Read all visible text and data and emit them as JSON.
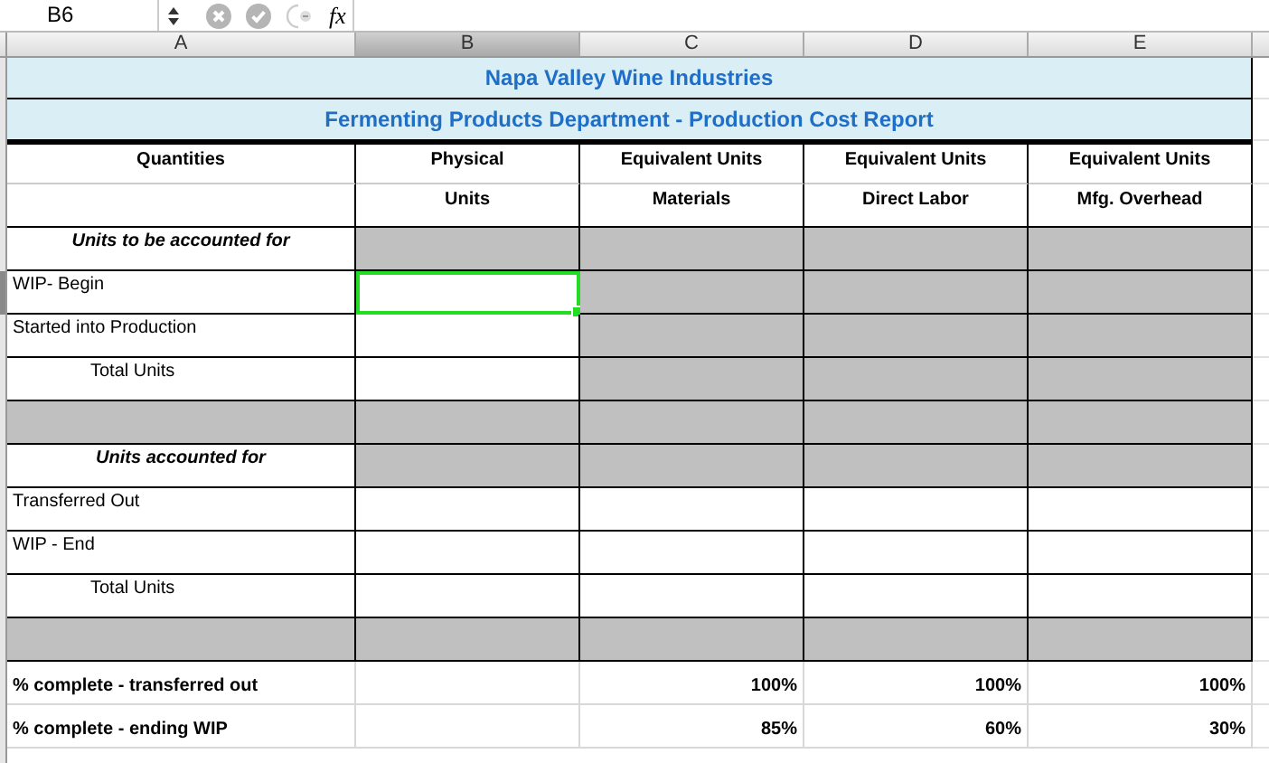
{
  "formula_bar": {
    "cell_ref": "B6",
    "fx": "fx"
  },
  "columns": [
    {
      "label": "A",
      "selected": false
    },
    {
      "label": "B",
      "selected": true
    },
    {
      "label": "C",
      "selected": false
    },
    {
      "label": "D",
      "selected": false
    },
    {
      "label": "E",
      "selected": false
    }
  ],
  "titles": [
    "Napa Valley Wine Industries",
    "Fermenting Products Department - Production Cost Report"
  ],
  "rows": [
    {
      "kind": "header",
      "cells": [
        {
          "text": "Quantities",
          "shaded": false,
          "selected": false
        },
        {
          "text": "Physical",
          "shaded": false,
          "selected": false
        },
        {
          "text": "Equivalent Units",
          "shaded": false,
          "selected": false
        },
        {
          "text": "Equivalent Units",
          "shaded": false,
          "selected": false
        },
        {
          "text": "Equivalent Units",
          "shaded": false,
          "selected": false
        }
      ]
    },
    {
      "kind": "header",
      "cells": [
        {
          "shaded": false,
          "selected": false
        },
        {
          "text": "Units",
          "shaded": false,
          "selected": false
        },
        {
          "text": "Materials",
          "shaded": false,
          "selected": false
        },
        {
          "text": "Direct Labor",
          "shaded": false,
          "selected": false
        },
        {
          "text": "Mfg. Overhead",
          "shaded": false,
          "selected": false
        }
      ]
    },
    {
      "kind": "section",
      "cells": [
        {
          "text": "Units to be accounted for",
          "shaded": false,
          "selected": false
        },
        {
          "shaded": true,
          "selected": false
        },
        {
          "shaded": true,
          "selected": false
        },
        {
          "shaded": true,
          "selected": false
        },
        {
          "shaded": true,
          "selected": false
        }
      ]
    },
    {
      "kind": "data",
      "cells": [
        {
          "text": "WIP- Begin",
          "shaded": false,
          "selected": false
        },
        {
          "shaded": false,
          "selected": true
        },
        {
          "shaded": true,
          "selected": false
        },
        {
          "shaded": true,
          "selected": false
        },
        {
          "shaded": true,
          "selected": false
        }
      ]
    },
    {
      "kind": "data",
      "cells": [
        {
          "text": "Started into Production",
          "shaded": false,
          "selected": false
        },
        {
          "shaded": false,
          "selected": false
        },
        {
          "shaded": true,
          "selected": false
        },
        {
          "shaded": true,
          "selected": false
        },
        {
          "shaded": true,
          "selected": false
        }
      ]
    },
    {
      "kind": "total",
      "cells": [
        {
          "text": "Total Units",
          "shaded": false,
          "selected": false
        },
        {
          "shaded": false,
          "selected": false
        },
        {
          "shaded": true,
          "selected": false
        },
        {
          "shaded": true,
          "selected": false
        },
        {
          "shaded": true,
          "selected": false
        }
      ]
    },
    {
      "kind": "data",
      "cells": [
        {
          "shaded": true,
          "selected": false
        },
        {
          "shaded": true,
          "selected": false
        },
        {
          "shaded": true,
          "selected": false
        },
        {
          "shaded": true,
          "selected": false
        },
        {
          "shaded": true,
          "selected": false
        }
      ]
    },
    {
      "kind": "section",
      "cells": [
        {
          "text": "Units accounted for",
          "shaded": false,
          "selected": false
        },
        {
          "shaded": true,
          "selected": false
        },
        {
          "shaded": true,
          "selected": false
        },
        {
          "shaded": true,
          "selected": false
        },
        {
          "shaded": true,
          "selected": false
        }
      ]
    },
    {
      "kind": "data",
      "cells": [
        {
          "text": "Transferred Out",
          "shaded": false,
          "selected": false
        },
        {
          "shaded": false,
          "selected": false
        },
        {
          "shaded": false,
          "selected": false
        },
        {
          "shaded": false,
          "selected": false
        },
        {
          "shaded": false,
          "selected": false
        }
      ]
    },
    {
      "kind": "data",
      "cells": [
        {
          "text": "WIP - End",
          "shaded": false,
          "selected": false
        },
        {
          "shaded": false,
          "selected": false
        },
        {
          "shaded": false,
          "selected": false
        },
        {
          "shaded": false,
          "selected": false
        },
        {
          "shaded": false,
          "selected": false
        }
      ]
    },
    {
      "kind": "total",
      "cells": [
        {
          "text": "Total Units",
          "shaded": false,
          "selected": false
        },
        {
          "shaded": false,
          "selected": false
        },
        {
          "shaded": false,
          "selected": false
        },
        {
          "shaded": false,
          "selected": false
        },
        {
          "shaded": false,
          "selected": false
        }
      ]
    },
    {
      "kind": "data",
      "cells": [
        {
          "shaded": true,
          "selected": false
        },
        {
          "shaded": true,
          "selected": false
        },
        {
          "shaded": true,
          "selected": false
        },
        {
          "shaded": true,
          "selected": false
        },
        {
          "shaded": true,
          "selected": false
        }
      ]
    },
    {
      "kind": "percent",
      "cells": [
        {
          "text": "% complete - transferred out",
          "shaded": false,
          "selected": false
        },
        {
          "shaded": false,
          "selected": false
        },
        {
          "text": "100%",
          "shaded": false,
          "selected": false
        },
        {
          "text": "100%",
          "shaded": false,
          "selected": false
        },
        {
          "text": "100%",
          "shaded": false,
          "selected": false
        }
      ]
    },
    {
      "kind": "percent",
      "cells": [
        {
          "text": "% complete - ending WIP",
          "shaded": false,
          "selected": false
        },
        {
          "shaded": false,
          "selected": false
        },
        {
          "text": "85%",
          "shaded": false,
          "selected": false
        },
        {
          "text": "60%",
          "shaded": false,
          "selected": false
        },
        {
          "text": "30%",
          "shaded": false,
          "selected": false
        }
      ]
    }
  ]
}
